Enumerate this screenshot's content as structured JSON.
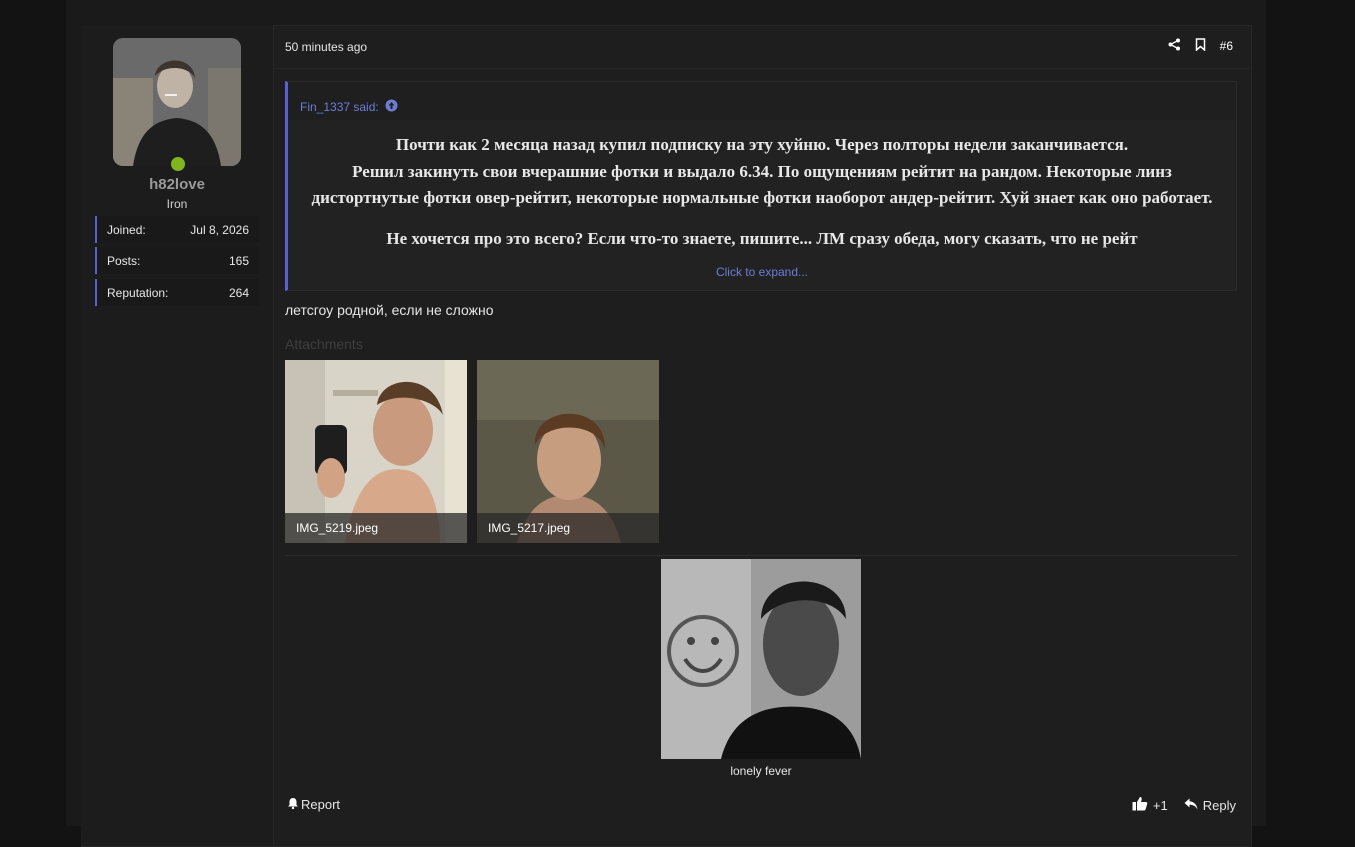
{
  "post": {
    "time": "50 minutes ago",
    "number": "#6",
    "message": "летсгоу родной, если не сложно"
  },
  "user": {
    "name": "h82love",
    "title": "Iron",
    "stats": [
      {
        "label": "Joined:",
        "value": "Jul 8, 2026"
      },
      {
        "label": "Posts:",
        "value": "165"
      },
      {
        "label": "Reputation:",
        "value": "264"
      }
    ]
  },
  "quote": {
    "author": "Fin_1337 said:",
    "lines": [
      "Почти как 2 месяца назад купил подписку на эту хуйню. Через полторы недели заканчивается.",
      "Решил закинуть свои вчерашние фотки и выдало 6.34. По ощущениям рейтит на рандом. Некоторые линз дистортнутые фотки овер-рейтит, некоторые нормальные фотки наоборот андер-рейтит. Хуй знает как оно работает.",
      "Не хочется про это всего? Если что-то знаете, пишите... ЛМ сразу обеда, могу сказать, что не рейт"
    ],
    "expand": "Click to expand..."
  },
  "attachments": {
    "title": "Attachments",
    "files": [
      "IMG_5219.jpeg",
      "IMG_5217.jpeg"
    ]
  },
  "signature": {
    "caption": "lonely fever"
  },
  "footer": {
    "report": "Report",
    "like_count": "+1",
    "reply": "Reply"
  },
  "colors": {
    "accent": "#5a5fd6",
    "online": "#7fb61c",
    "link": "#6b7ed6"
  }
}
